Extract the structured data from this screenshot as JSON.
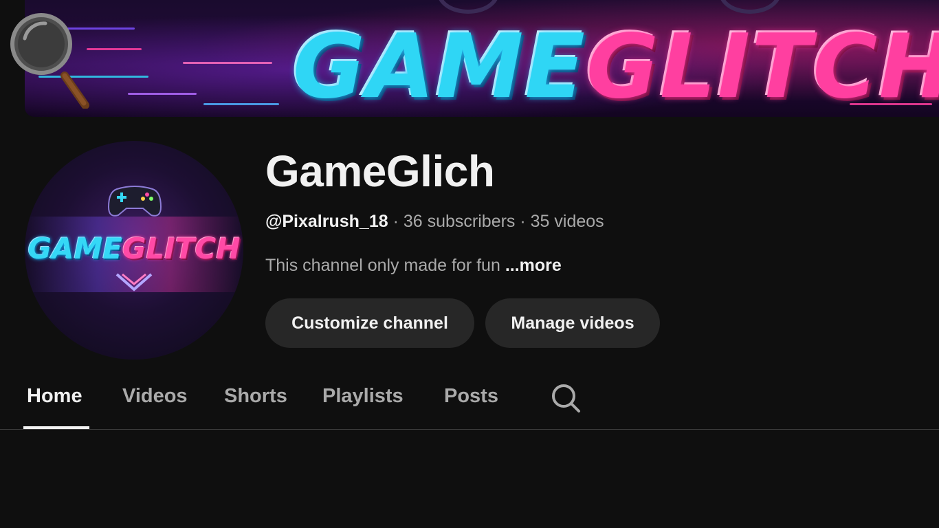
{
  "banner": {
    "title_part1": "GAME",
    "title_part2": "GLITCH"
  },
  "avatar": {
    "text_part1": "GAME",
    "text_part2": "GLITCH"
  },
  "channel": {
    "name": "GameGlich",
    "handle": "@Pixalrush_18",
    "subscribers": "36 subscribers",
    "videos": "35 videos",
    "separator": " · ",
    "description": "This channel only made for fun",
    "more_label": "...more"
  },
  "buttons": {
    "customize": "Customize channel",
    "manage": "Manage videos"
  },
  "tabs": [
    {
      "label": "Home",
      "active": true
    },
    {
      "label": "Videos",
      "active": false
    },
    {
      "label": "Shorts",
      "active": false
    },
    {
      "label": "Playlists",
      "active": false
    },
    {
      "label": "Posts",
      "active": false
    }
  ],
  "icons": {
    "overlay": "magnifier-icon",
    "tab_search": "search-icon"
  },
  "colors": {
    "background": "#0f0f0f",
    "button_bg": "#272727",
    "text_primary": "#f1f1f1",
    "text_secondary": "#aaaaaa",
    "brand_cyan": "#2fd6f5",
    "brand_pink": "#ff3fa0"
  }
}
